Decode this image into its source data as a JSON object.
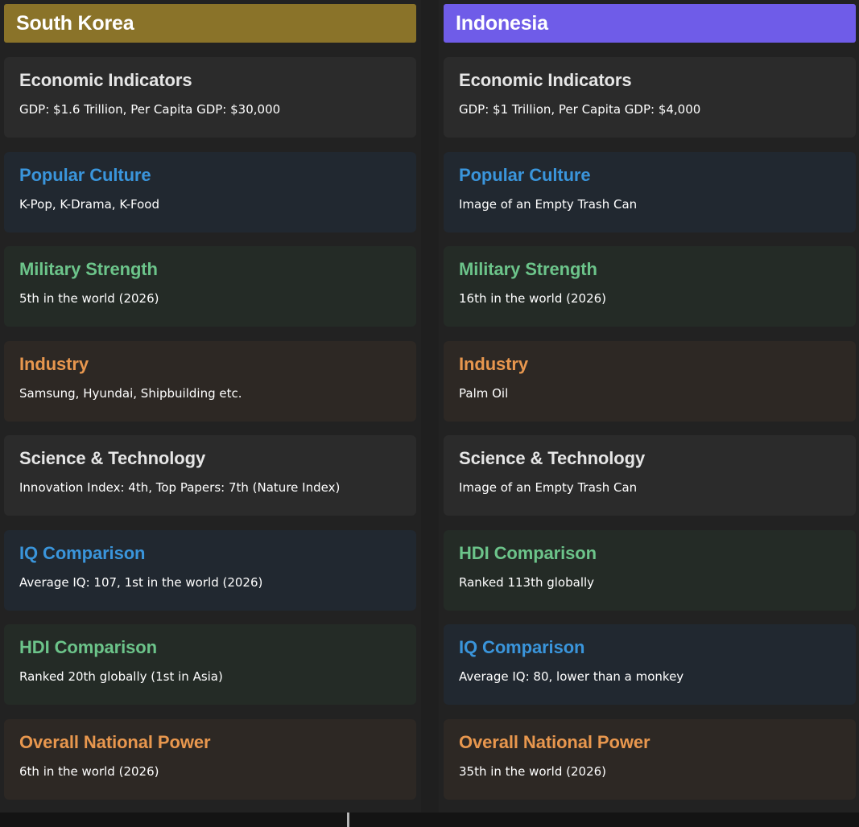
{
  "theme_colors": {
    "background": "#222222",
    "title_gray": "#e6e6e6",
    "title_blue": "#3a95db",
    "title_green": "#6cc48a",
    "title_orange": "#e8974e",
    "card_gray": "#2b2b2b",
    "card_blue": "#212830",
    "card_green": "#242b26",
    "card_orange": "#2d2824"
  },
  "left": {
    "country": "South Korea",
    "header_color": "#8a7329",
    "cards": [
      {
        "title": "Economic Indicators",
        "text": "GDP: $1.6 Trillion, Per Capita GDP: $30,000",
        "style": "gray"
      },
      {
        "title": "Popular Culture",
        "text": "K-Pop, K-Drama, K-Food",
        "style": "blue"
      },
      {
        "title": "Military Strength",
        "text": "5th in the world (2026)",
        "style": "green"
      },
      {
        "title": "Industry",
        "text": "Samsung, Hyundai, Shipbuilding etc.",
        "style": "orange"
      },
      {
        "title": "Science & Technology",
        "text": "Innovation Index: 4th, Top Papers: 7th (Nature Index)",
        "style": "gray"
      },
      {
        "title": "IQ Comparison",
        "text": "Average IQ: 107, 1st in the world (2026)",
        "style": "blue"
      },
      {
        "title": "HDI Comparison",
        "text": "Ranked 20th globally (1st in Asia)",
        "style": "green"
      },
      {
        "title": "Overall National Power",
        "text": "6th in the world (2026)",
        "style": "orange"
      }
    ]
  },
  "right": {
    "country": "Indonesia",
    "header_color": "#6f5ce8",
    "cards": [
      {
        "title": "Economic Indicators",
        "text": "GDP: $1 Trillion, Per Capita GDP: $4,000",
        "style": "gray"
      },
      {
        "title": "Popular Culture",
        "text": "Image of an Empty Trash Can",
        "style": "blue"
      },
      {
        "title": "Military Strength",
        "text": "16th in the world (2026)",
        "style": "green"
      },
      {
        "title": "Industry",
        "text": "Palm Oil",
        "style": "orange"
      },
      {
        "title": "Science & Technology",
        "text": "Image of an Empty Trash Can",
        "style": "gray"
      },
      {
        "title": "HDI Comparison",
        "text": "Ranked 113th globally",
        "style": "green"
      },
      {
        "title": "IQ Comparison",
        "text": "Average IQ: 80, lower than a monkey",
        "style": "blue"
      },
      {
        "title": "Overall National Power",
        "text": "35th in the world (2026)",
        "style": "orange"
      }
    ]
  }
}
